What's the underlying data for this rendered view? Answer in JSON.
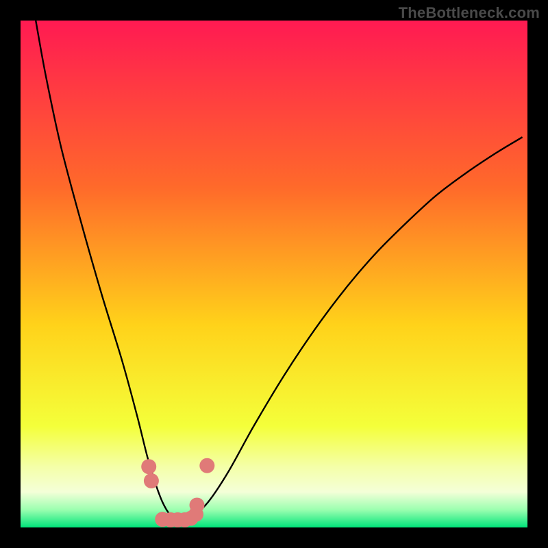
{
  "watermark": "TheBottleneck.com",
  "chart_data": {
    "type": "line",
    "title": "",
    "xlabel": "",
    "ylabel": "",
    "xlim": [
      0,
      100
    ],
    "ylim": [
      0,
      100
    ],
    "gradient_stops": [
      {
        "offset": 0,
        "color": "#ff1a52"
      },
      {
        "offset": 0.33,
        "color": "#ff6a2a"
      },
      {
        "offset": 0.6,
        "color": "#ffd21a"
      },
      {
        "offset": 0.8,
        "color": "#f4ff3a"
      },
      {
        "offset": 0.88,
        "color": "#f4ffa8"
      },
      {
        "offset": 0.93,
        "color": "#f4ffd8"
      },
      {
        "offset": 0.965,
        "color": "#9bffb0"
      },
      {
        "offset": 1.0,
        "color": "#00e47a"
      }
    ],
    "series": [
      {
        "name": "bottleneck-curve",
        "x": [
          3,
          5,
          8,
          12,
          16,
          20,
          23,
          25,
          26.5,
          28,
          29.5,
          31,
          32.5,
          34,
          37,
          41,
          46,
          52,
          58,
          64,
          70,
          76,
          82,
          88,
          94,
          99
        ],
        "values": [
          100,
          89,
          75,
          60,
          46,
          33,
          22,
          14,
          9,
          5,
          2.5,
          1.5,
          1.5,
          2.2,
          5,
          11,
          20,
          30,
          39,
          47,
          54,
          60,
          65.5,
          70,
          74,
          77
        ]
      }
    ],
    "markers": {
      "name": "highlight-points",
      "color": "#e07a78",
      "radius": 11,
      "x": [
        25.3,
        25.8,
        28.0,
        29.6,
        31.0,
        32.4,
        33.6,
        34.6,
        34.8,
        36.8
      ],
      "values": [
        12.0,
        9.2,
        1.6,
        1.5,
        1.5,
        1.5,
        1.8,
        2.6,
        4.4,
        12.2
      ]
    }
  }
}
